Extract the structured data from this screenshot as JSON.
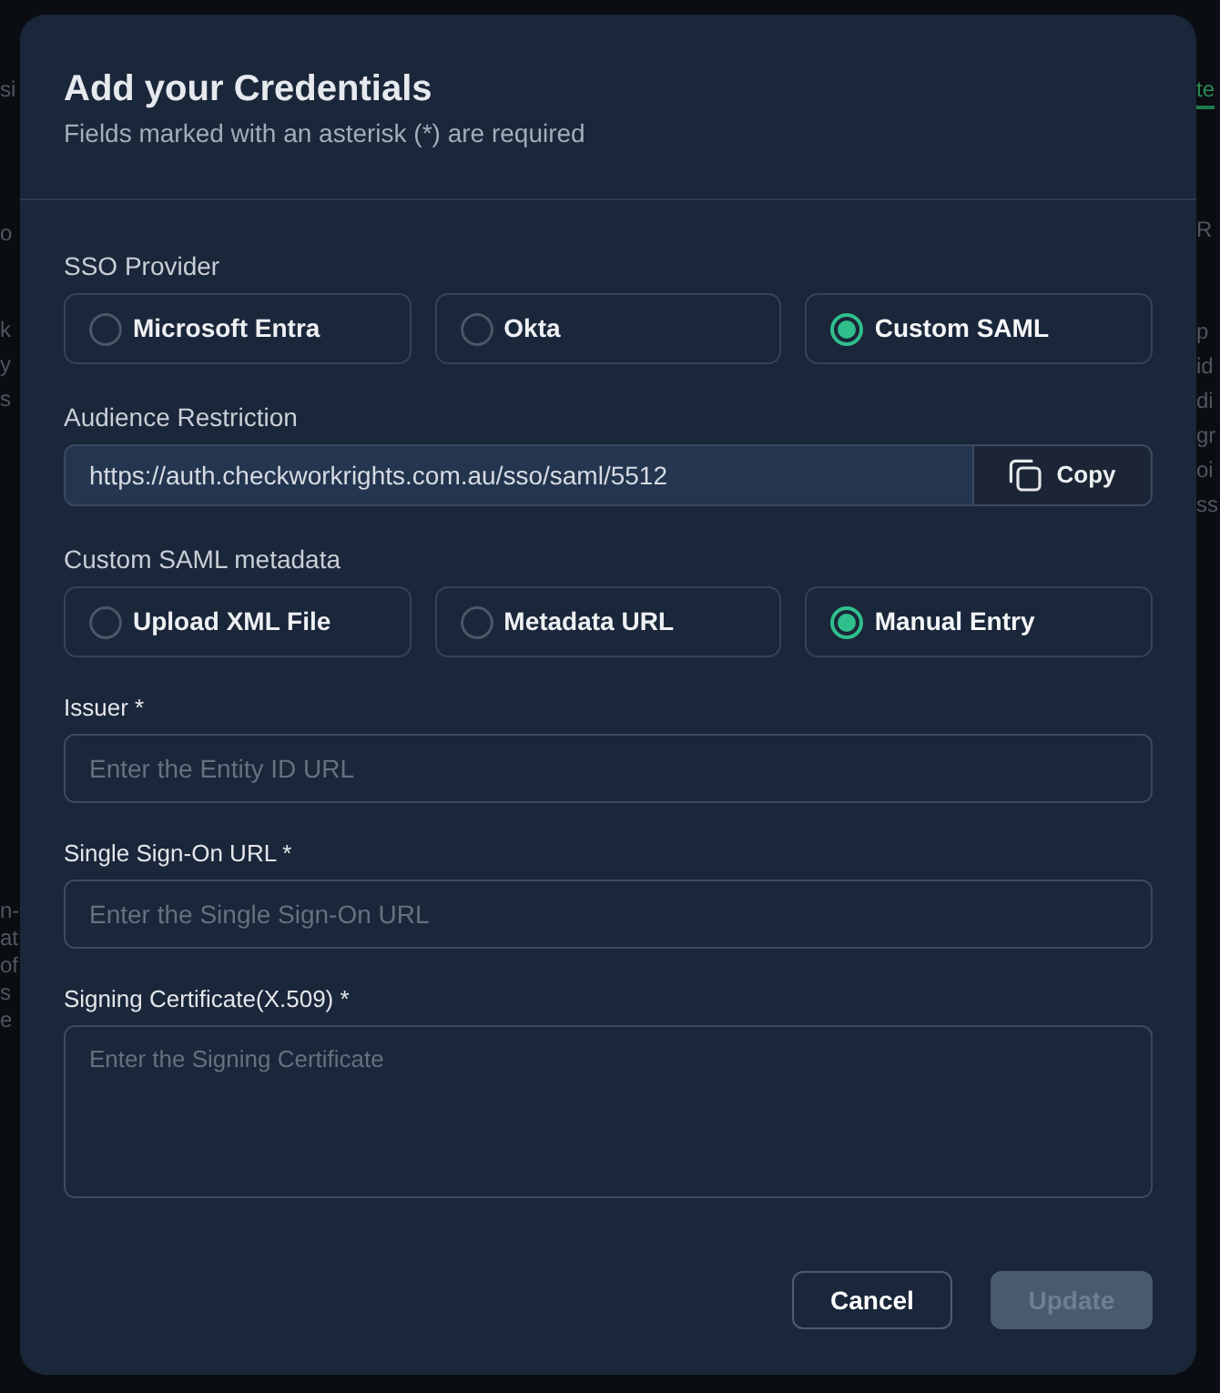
{
  "background": {
    "left_texts": [
      "si",
      "o",
      "k",
      "y",
      "s",
      "n-",
      "at",
      "of",
      "s",
      "e"
    ],
    "right_tab": {
      "label": "te",
      "selected": true
    },
    "right_texts": [
      "R",
      "p",
      "id",
      "di",
      "gr",
      "oi",
      "ss"
    ]
  },
  "dialog": {
    "title": "Add your Credentials",
    "subtitle": "Fields marked with an asterisk (*) are required",
    "sections": [
      {
        "kind": "radio_group",
        "label": "SSO Provider",
        "options": [
          {
            "label": "Microsoft Entra",
            "selected": false
          },
          {
            "label": "Okta",
            "selected": false
          },
          {
            "label": "Custom SAML",
            "selected": true
          }
        ]
      },
      {
        "kind": "copy_field",
        "label": "Audience Restriction",
        "value": "https://auth.checkworkrights.com.au/sso/saml/5512",
        "button": "Copy"
      },
      {
        "kind": "radio_group",
        "label": "Custom SAML metadata",
        "options": [
          {
            "label": "Upload XML File",
            "selected": false
          },
          {
            "label": "Metadata URL",
            "selected": false
          },
          {
            "label": "Manual Entry",
            "selected": true
          }
        ]
      },
      {
        "kind": "text_input",
        "label": "Issuer *",
        "placeholder": "Enter the Entity ID URL"
      },
      {
        "kind": "text_input",
        "label": "Single Sign-On URL *",
        "placeholder": "Enter the Single Sign-On URL"
      },
      {
        "kind": "textarea",
        "label": "Signing Certificate(X.509) *",
        "placeholder": "Enter the Signing Certificate"
      }
    ],
    "buttons": [
      {
        "label": "Cancel",
        "kind": "secondary",
        "disabled": false
      },
      {
        "label": "Update",
        "kind": "primary",
        "disabled": true
      }
    ]
  }
}
